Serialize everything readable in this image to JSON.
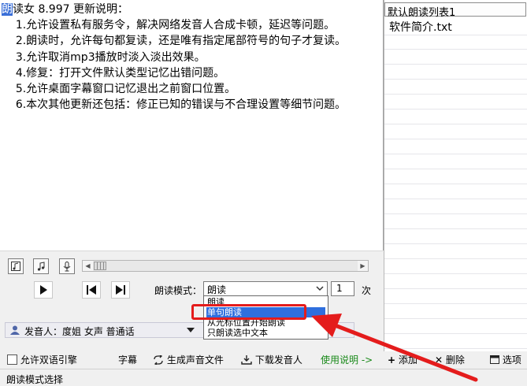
{
  "editor": {
    "lines": [
      "读女 8.997 更新说明：",
      "    1.允许设置私有服务令，解决网络发音人合成卡顿，延迟等问题。",
      "    2.朗读时，允许每句都复读，还是唯有指定尾部符号的句子才复读。",
      "    3.允许取消mp3播放时淡入淡出效果。",
      "    4.修复：打开文件默认类型记忆出错问题。",
      "    5.允许桌面字幕窗口记忆退出之前窗口位置。",
      "    6.本次其他更新还包括：修正已知的错误与不合理设置等细节问题。"
    ],
    "selected_char": "朗"
  },
  "playlist": {
    "header": "默认朗读列表1",
    "items": [
      "软件简介.txt"
    ]
  },
  "controls": {
    "mode_label": "朗读模式：",
    "mode_value": "朗读",
    "mode_options": [
      "朗读",
      "单句朗读",
      "从光标位置开始朗读",
      "只朗读选中文本"
    ],
    "highlighted_option": 1,
    "repeat_count": "1",
    "repeat_unit": "次",
    "speaker": "发音人：度姐 女声 普通话"
  },
  "bottom": {
    "bilingual": "允许双语引擎",
    "subtitle": "字幕",
    "generate": "生成声音文件",
    "download": "下载发音人",
    "help": "使用说明 ->",
    "add": "添加",
    "delete": "删除",
    "options": "选项"
  },
  "status": "朗读模式选择",
  "colors": {
    "selection": "#3a6fd8",
    "highlight": "#2f6fde",
    "callout": "#e41c1c",
    "help_link": "#1a8a1a"
  }
}
